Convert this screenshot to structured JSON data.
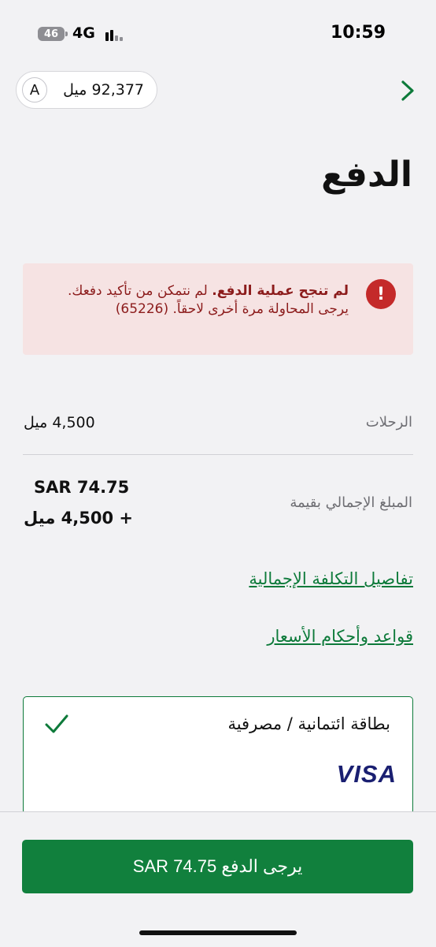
{
  "status_bar": {
    "battery": "46",
    "network": "4G",
    "time": "10:59"
  },
  "header": {
    "avatar_letter": "A",
    "miles_balance": "92,377 ميل"
  },
  "page_title": "الدفع",
  "error": {
    "bold_text": "لم تنجح عملية الدفع.",
    "message": " لم نتمكن من تأكيد دفعك. يرجى المحاولة مرة أخرى لاحقاً. (65226)",
    "icon": "exclamation-icon"
  },
  "summary": {
    "flights_label": "الرحلات",
    "flights_value": "4,500 ميل",
    "total_label": "المبلغ الإجمالي بقيمة",
    "total_cash": "SAR 74.75",
    "total_miles": "+ 4,500 ميل"
  },
  "links": {
    "cost_details": "تفاصيل التكلفة الإجمالية",
    "fare_rules": "قواعد وأحكام الأسعار"
  },
  "payment_method": {
    "title": "بطاقة ائتمانية / مصرفية",
    "brand": "VISA",
    "selected": true
  },
  "pay_button": {
    "label": "يرجى الدفع SAR 74.75"
  },
  "colors": {
    "brand_green": "#11803d",
    "link_green": "#0d7a3a",
    "error_red": "#c42a2a",
    "error_bg": "#f6e3e3"
  }
}
